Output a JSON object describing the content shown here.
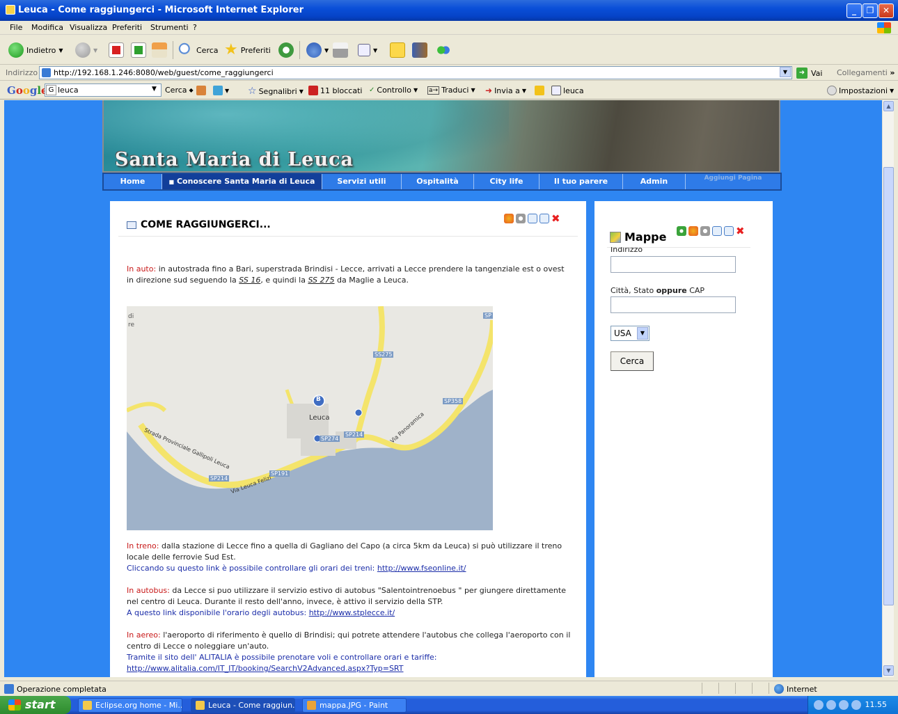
{
  "window": {
    "title": "Leuca - Come raggiungerci - Microsoft Internet Explorer",
    "min": "_",
    "max": "❐",
    "close": "✕"
  },
  "menu": [
    "File",
    "Modifica",
    "Visualizza",
    "Preferiti",
    "Strumenti",
    "?"
  ],
  "toolbar": {
    "back": "Indietro",
    "search": "Cerca",
    "favorites": "Preferiti"
  },
  "address": {
    "label": "Indirizzo",
    "url": "http://192.168.1.246:8080/web/guest/come_raggiungerci",
    "go": "Vai",
    "links": "Collegamenti",
    "more": "»"
  },
  "google": {
    "logo": "Google",
    "query": "leuca",
    "search": "Cerca",
    "bookmarks": "Segnalibri",
    "blocked": "11 bloccati",
    "check": "Controllo",
    "translate": "Traduci",
    "send": "Invia a",
    "term": "leuca",
    "settings": "Impostazioni"
  },
  "banner": {
    "title": "Santa Maria di Leuca"
  },
  "nav": {
    "tabs": [
      "Home",
      "Conoscere Santa Maria di Leuca",
      "Servizi utili",
      "Ospitalità",
      "City life",
      "Il tuo parere",
      "Admin"
    ],
    "add_page": "Aggiungi Pagina"
  },
  "content": {
    "title": "COME RAGGIUNGERCI...",
    "auto_label": "In auto:",
    "auto_text_1": "in autostrada fino a Bari, superstrada Brindisi - Lecce, arrivati a Lecce prendere la tangenziale est o ovest in direzione sud seguendo la",
    "ss16": "SS 16",
    "auto_text_2": ", e quindi la",
    "ss275": "SS 275",
    "auto_text_3": "da Maglie a Leuca.",
    "treno_label": "In treno:",
    "treno_text": "dalla stazione di Lecce fino a quella di Gagliano del Capo (a circa 5km da Leuca) si può utilizzare il treno locale delle ferrovie Sud Est.",
    "treno_link_text": "Cliccando su questo link è possibile controllare gli orari dei treni:",
    "treno_url": "http://www.fseonline.it/",
    "bus_label": "In autobus:",
    "bus_text": "da Lecce si puo utilizzare il servizio estivo di autobus \"Salentointrenoebus \" per giungere direttamente nel centro di Leuca. Durante il resto dell'anno, invece, è attivo il servizio della STP.",
    "bus_link_text": "A questo link disponibile l'orario degli autobus:",
    "bus_url": "http://www.stplecce.it/",
    "aereo_label": "In aereo:",
    "aereo_text": "l'aeroporto di riferimento è quello di Brindisi; qui potrete attendere l'autobus che collega l'aeroporto con il centro di Lecce o noleggiare un'auto.",
    "aereo_link_text": "Tramite il sito dell' ALITALIA è possibile prenotare voli e controllare orari e tariffe:",
    "aereo_url": "http://www.alitalia.com/IT_IT/booking/SearchV2Advanced.aspx?Typ=SRT"
  },
  "map_labels": {
    "town": "Leuca",
    "ss275": "SS275",
    "sp358": "SP358",
    "sp214a": "SP214",
    "sp214b": "SP214",
    "sp191": "SP191",
    "sp274": "SP274",
    "sp": "SP",
    "gallipoli": "Strada Provinciale Gallipoli Leuca",
    "panoramica": "Via Panoramica",
    "felizi": "Via Leuca Felizi",
    "marker": "B",
    "di": "di",
    "re": "re"
  },
  "sidebar": {
    "title": "Mappe",
    "address_label": "Indirizzo",
    "city_label_1": "Città, Stato",
    "city_label_2": "oppure",
    "city_label_3": "CAP",
    "country": "USA",
    "search_button": "Cerca"
  },
  "status": {
    "text": "Operazione completata",
    "zone": "Internet"
  },
  "taskbar": {
    "start": "start",
    "tasks": [
      "Eclipse.org home - Mi...",
      "Leuca - Come raggiun...",
      "mappa.JPG - Paint"
    ],
    "clock": "11.55"
  }
}
